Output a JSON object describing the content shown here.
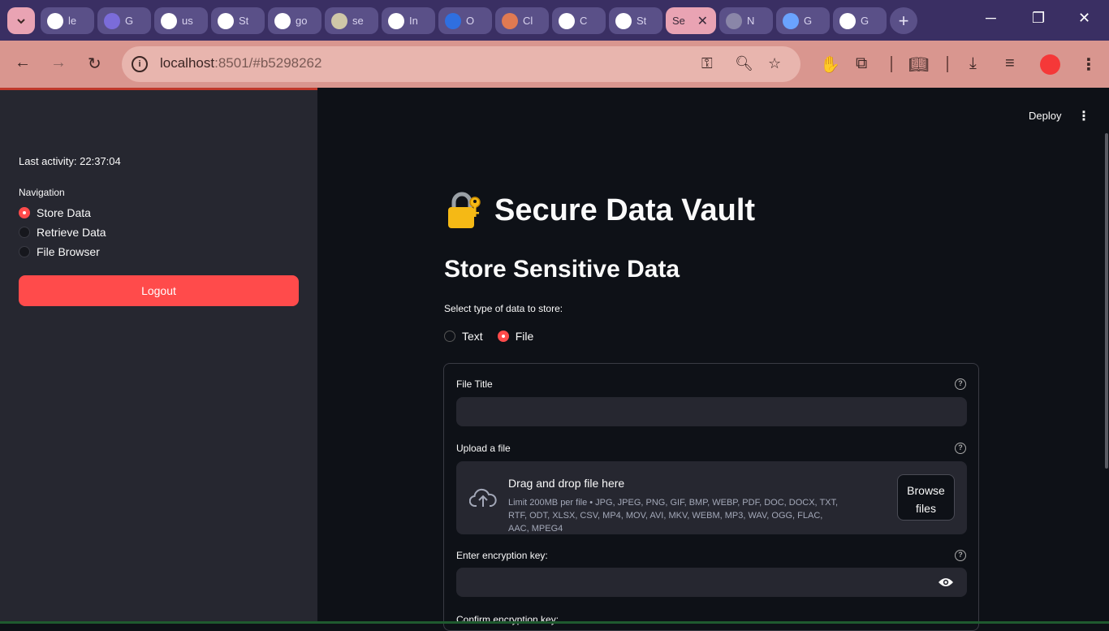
{
  "browser": {
    "tabs": [
      {
        "title": "le",
        "icon": "github-icon",
        "color": "#ffffff"
      },
      {
        "title": "G",
        "icon": "list-icon",
        "color": "#7b6cd9"
      },
      {
        "title": "us",
        "icon": "github-icon",
        "color": "#ffffff"
      },
      {
        "title": "St",
        "icon": "openai-icon",
        "color": "#ffffff"
      },
      {
        "title": "go",
        "icon": "google-icon",
        "color": "#ffffff"
      },
      {
        "title": "se",
        "icon": "crown-icon",
        "color": "#cfc7a8"
      },
      {
        "title": "In",
        "icon": "gmail-icon",
        "color": "#ffffff"
      },
      {
        "title": "O",
        "icon": "person-icon",
        "color": "#2f6fe0"
      },
      {
        "title": "Cl",
        "icon": "claude-icon",
        "color": "#e07a52"
      },
      {
        "title": "C",
        "icon": "anthropic-icon",
        "color": "#ffffff"
      },
      {
        "title": "St",
        "icon": "openai-icon",
        "color": "#ffffff"
      },
      {
        "title": "Se",
        "icon": "streamlit-icon",
        "color": "#e9a3b3",
        "active": true
      },
      {
        "title": "N",
        "icon": "globe-icon",
        "color": "#8a86a8"
      },
      {
        "title": "G",
        "icon": "gemini-icon",
        "color": "#6aa3ff"
      },
      {
        "title": "G",
        "icon": "slash-circle-icon",
        "color": "#ffffff"
      }
    ],
    "url_host": "localhost",
    "url_rest": ":8501/#b5298262"
  },
  "sidebar": {
    "activity": "Last activity: 22:37:04",
    "nav_label": "Navigation",
    "items": [
      {
        "label": "Store Data",
        "selected": true
      },
      {
        "label": "Retrieve Data",
        "selected": false
      },
      {
        "label": "File Browser",
        "selected": false
      }
    ],
    "logout": "Logout"
  },
  "header": {
    "deploy": "Deploy",
    "menu": "⋮"
  },
  "main": {
    "title": "Secure Data Vault",
    "subtitle": "Store Sensitive Data",
    "select_label": "Select type of data to store:",
    "type_options": [
      {
        "label": "Text",
        "selected": false
      },
      {
        "label": "File",
        "selected": true
      }
    ],
    "form": {
      "file_title_label": "File Title",
      "upload_label": "Upload a file",
      "drag_drop": "Drag and drop file here",
      "limit": "Limit 200MB per file • JPG, JPEG, PNG, GIF, BMP, WEBP, PDF, DOC, DOCX, TXT, RTF, ODT, XLSX, CSV, MP4, MOV, AVI, MKV, WEBM, MP3, WAV, OGG, FLAC, AAC, MPEG4",
      "browse_line1": "Browse",
      "browse_line2": "files",
      "key_label": "Enter encryption key:",
      "confirm_label": "Confirm encryption key:",
      "help": "?"
    }
  },
  "colors": {
    "accent": "#ff4b4b",
    "sidebar_bg": "#262730",
    "main_bg": "#0e1117"
  }
}
